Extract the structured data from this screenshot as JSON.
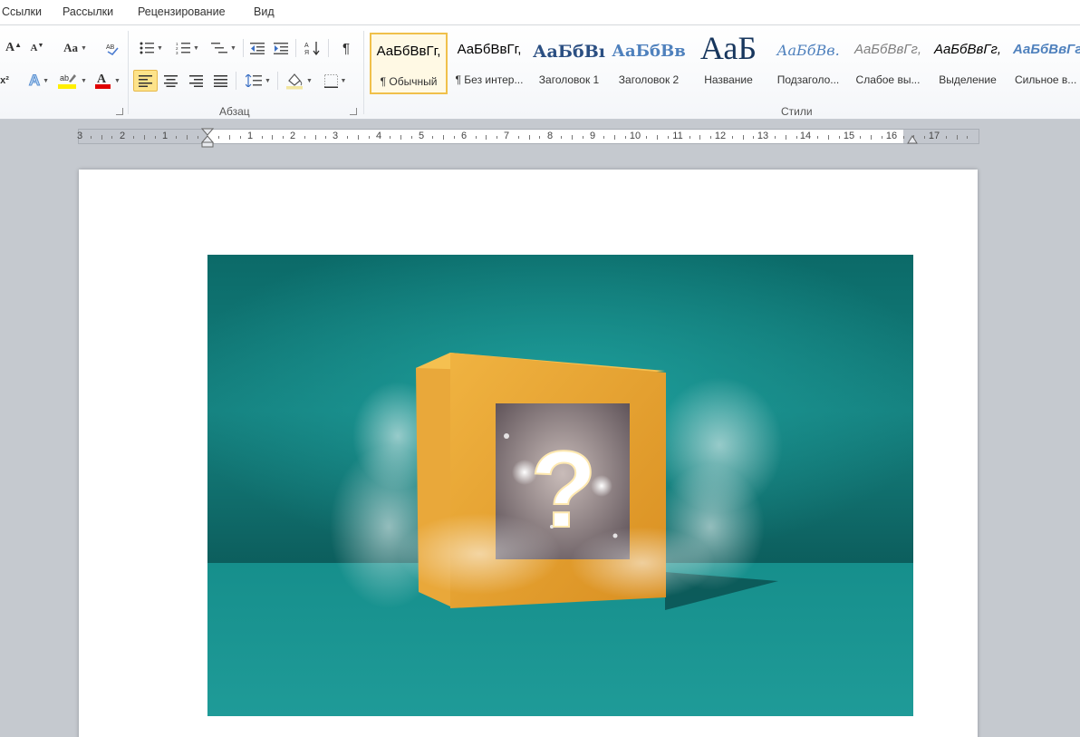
{
  "tabs": [
    "Ссылки",
    "Рассылки",
    "Рецензирование",
    "Вид"
  ],
  "ribbon": {
    "paragraph_group_label": "Абзац",
    "styles_group_label": "Стили",
    "font_size_label": "Aa",
    "pilcrow": "¶",
    "superscript_label": "x²",
    "styles": [
      {
        "sample": "АаБбВвГг,",
        "name": "¶ Обычный"
      },
      {
        "sample": "АаБбВвГг,",
        "name": "¶ Без интер..."
      },
      {
        "sample": "АаБбВı",
        "name": "Заголовок 1"
      },
      {
        "sample": "АаБбВв",
        "name": "Заголовок 2"
      },
      {
        "sample": "АаБ",
        "name": "Название"
      },
      {
        "sample": "АаБбВв.",
        "name": "Подзаголо..."
      },
      {
        "sample": "АаБбВвГг,",
        "name": "Слабое вы..."
      },
      {
        "sample": "АаБбВвГг,",
        "name": "Выделение"
      },
      {
        "sample": "АаБбВвГг",
        "name": "Сильное в..."
      }
    ]
  },
  "ruler": {
    "labels": [
      "3",
      "2",
      "1",
      "1",
      "2",
      "3",
      "4",
      "5",
      "6",
      "7",
      "8",
      "9",
      "10",
      "11",
      "12",
      "13",
      "14",
      "15",
      "16",
      "17"
    ]
  },
  "colors": {
    "accent_highlight": "#fde38a",
    "font_color": "#e00000",
    "highlight_color": "#ffef00",
    "teal_background": "#1a8b8a",
    "box_orange": "#e8a435"
  },
  "document": {
    "image_description_icon": "mystery-box-image"
  }
}
